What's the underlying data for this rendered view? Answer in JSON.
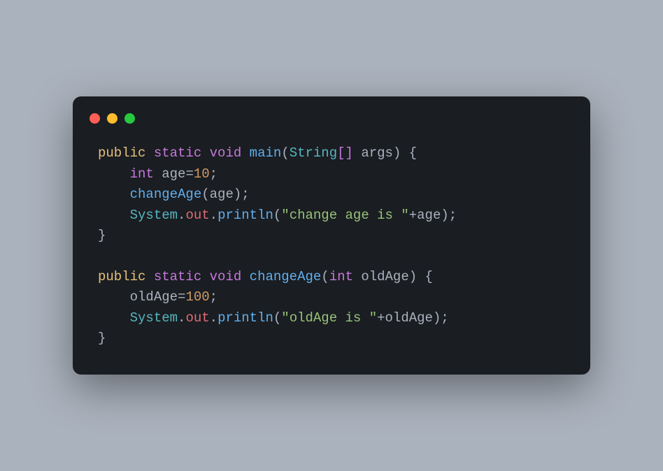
{
  "code": {
    "line1": {
      "kw1": "public",
      "kw2": "static",
      "kw3": "void",
      "fn": "main",
      "lparen": "(",
      "type": "String",
      "brackets": "[]",
      "param": " args",
      "rparen": ")",
      "lbrace": " {"
    },
    "line2": {
      "indent": "    ",
      "type": "int",
      "var": " age",
      "eq": "=",
      "num": "10",
      "semi": ";"
    },
    "line3": {
      "indent": "    ",
      "fn": "changeAge",
      "lparen": "(",
      "arg": "age",
      "rparen": ")",
      "semi": ";"
    },
    "line4": {
      "indent": "    ",
      "obj1": "System",
      "dot1": ".",
      "obj2": "out",
      "dot2": ".",
      "fn": "println",
      "lparen": "(",
      "str": "\"change age is \"",
      "plus": "+",
      "var": "age",
      "rparen": ")",
      "semi": ";"
    },
    "line5": {
      "rbrace": "}"
    },
    "line6": {
      "blank": " "
    },
    "line7": {
      "kw1": "public",
      "kw2": "static",
      "kw3": "void",
      "fn": "changeAge",
      "lparen": "(",
      "type": "int",
      "param": " oldAge",
      "rparen": ")",
      "lbrace": " {"
    },
    "line8": {
      "indent": "    ",
      "var": "oldAge",
      "eq": "=",
      "num": "100",
      "semi": ";"
    },
    "line9": {
      "indent": "    ",
      "obj1": "System",
      "dot1": ".",
      "obj2": "out",
      "dot2": ".",
      "fn": "println",
      "lparen": "(",
      "str": "\"oldAge is \"",
      "plus": "+",
      "var": "oldAge",
      "rparen": ")",
      "semi": ";"
    },
    "line10": {
      "rbrace": "}"
    }
  }
}
